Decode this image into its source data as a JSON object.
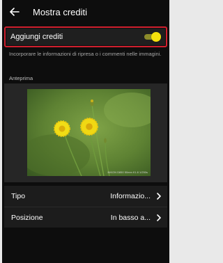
{
  "appbar": {
    "title": "Mostra crediti",
    "back_icon": "arrow-left-icon"
  },
  "credit_setting": {
    "label": "Aggiungi crediti",
    "toggle_on": true,
    "toggle_color": "#f5e10c",
    "highlight_color": "#d01f2e"
  },
  "description": "Incorporare le informazioni di ripresa o i commenti nelle immagini.",
  "preview": {
    "label": "Anteprima",
    "overlay_text": "NIKON D850 50mm f/1.8 1/250s"
  },
  "rows": [
    {
      "label": "Tipo",
      "value": "Informazio...",
      "icon": "chevron-right-icon"
    },
    {
      "label": "Posizione",
      "value": "In basso a...",
      "icon": "chevron-right-icon"
    }
  ]
}
